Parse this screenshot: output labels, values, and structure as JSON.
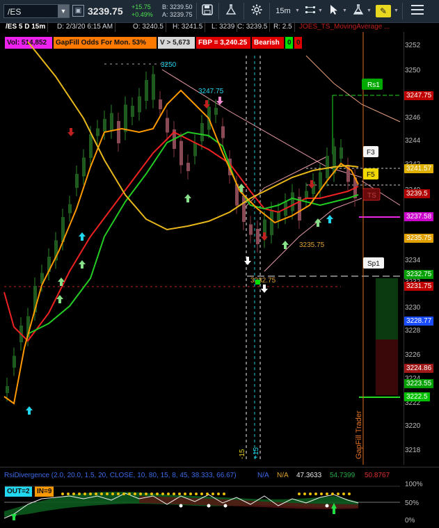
{
  "toolbar": {
    "symbol": "/ES",
    "last_price": "3239.75",
    "change_abs": "+15.75",
    "change_pct": "+0.49%",
    "bid": "B: 3239.50",
    "ask": "A: 3239.75",
    "timeframe": "15m"
  },
  "info_bar": {
    "chart_id": "/ES 5 D 15m",
    "date": "D: 2/3/20 6:15 AM",
    "open": "O: 3240.5",
    "high": "H: 3241.5",
    "low": "L: 3239",
    "close": "C: 3239.5",
    "range": "R: 2.5",
    "study_name": "JOES_TS_MovingAverage ..."
  },
  "badges": {
    "volume": "Vol: 514,852",
    "gapfill_odds": "GapFill Odds For Mon. 53%",
    "vol_threshold": "V > 5,673",
    "fbp": "FBP = 3,240.25",
    "bias": "Bearish",
    "count_a": "0",
    "count_b": "0"
  },
  "price_axis": {
    "ticks": [
      "3252",
      "3250",
      "3248",
      "3246",
      "3244",
      "3242",
      "3240",
      "3238",
      "3236",
      "3234",
      "3232",
      "3230",
      "3228",
      "3226",
      "3224",
      "3222",
      "3220",
      "3218"
    ],
    "tags": [
      {
        "text": "3247.75",
        "bg": "#c00000"
      },
      {
        "text": "3241.57",
        "bg": "#e0b000"
      },
      {
        "text": "3239.5",
        "bg": "#b00000"
      },
      {
        "text": "3237.58",
        "bg": "#cc00cc"
      },
      {
        "text": "3235.75",
        "bg": "#e0a000"
      },
      {
        "text": "3232.75",
        "bg": "#00a000"
      },
      {
        "text": "3231.75",
        "bg": "#c00000"
      },
      {
        "text": "3228.77",
        "bg": "#1a4bff"
      },
      {
        "text": "3224.86",
        "bg": "#a01818"
      },
      {
        "text": "3223.55",
        "bg": "#00a000"
      },
      {
        "text": "3222.5",
        "bg": "#00c000"
      }
    ]
  },
  "levels": {
    "high_label": "3250",
    "lh_label": "3247.75",
    "support_label": "3235.75",
    "low_label": "3232.75",
    "rs1": "Rs1",
    "f3": "F3",
    "f5": "F5",
    "ts": "TS",
    "sp1": "Sp1",
    "gapfill_vertical": "GapFill Trader",
    "minus15": "-15",
    "plus15": "+15"
  },
  "indicator": {
    "name": "RsiDivergence (2.0, 20.0, 1.5, 20, CLOSE, 10, 80, 15, 8, 45, 38.333, 66.67)",
    "na_a": "N/A",
    "na_b": "N/A",
    "val1": "47.3633",
    "val2": "54.7399",
    "val3": "50.8767"
  },
  "lower": {
    "out_badge": "OUT=2",
    "in_badge": "IN=9",
    "axis": [
      "100%",
      "50%",
      "0%"
    ]
  },
  "colors": {
    "ma_fast": "#ff9900",
    "ma_mid": "#22cc22",
    "ma_slow": "#ee2222",
    "ma_yellow": "#e8b81a",
    "ma_pink": "#e89aa8",
    "up_arrow": "#88e088",
    "cyan_arrow": "#22d8f0",
    "down_arrow": "#c02020"
  }
}
